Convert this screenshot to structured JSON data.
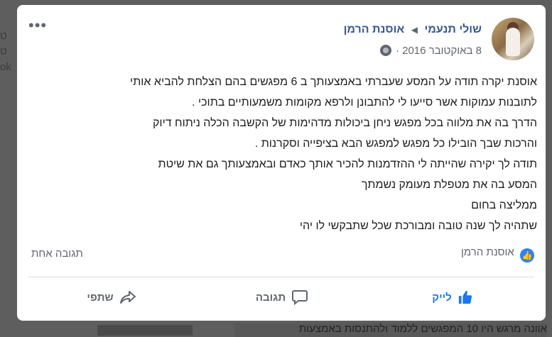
{
  "background": {
    "left_fragments": [
      "ט",
      "ט",
      "ok"
    ],
    "bottom_fragment": "אוונה מרגש היו 10 המפגשים ללמוד ולהתנסות באמצעות"
  },
  "post": {
    "author": "שולי תנעמי",
    "page": "אוסנת הרמן",
    "date": "8 באוקטובר 2016",
    "separator": "·",
    "lines": [
      "אוסנת יקרה תודה על המסע שעברתי באמצעותך ב 6 מפגשים בהם הצלחת להביא אותי",
      "לתובנות עמוקות אשר סייעו לי להתבונן ולרפא מקומות משמעותיים בתוכי .",
      "הדרך בה את מלווה בכל מפגש ניחן ביכולות מדהימות של הקשבה הכלה ניתוח דיוק",
      "והרכות שבך הובילו כל מפגש למפגש הבא בציפייה וסקרנות .",
      "תודה לך יקירה שהייתה לי ההזדמנות להכיר אותך כאדם ובאמצעותך גם את שיטת",
      "המסע בה את מטפלת מעומק נשמתך",
      "ממליצה בחום",
      "שתהיה לך שנה טובה ומבורכת שכל שתבקשי לו יהי"
    ],
    "reaction_name": "אוסנת הרמן",
    "comment_count": "תגובה אחת",
    "actions": {
      "like": "לייק",
      "comment": "תגובה",
      "share": "שתפי"
    }
  },
  "icons": [
    "more-icon",
    "globe-icon",
    "like-badge-icon",
    "like-icon",
    "comment-icon",
    "share-icon",
    "caret-icon"
  ],
  "colors": {
    "link": "#385898",
    "like_blue": "#1877f2",
    "meta": "#606770",
    "text": "#1c1e21"
  }
}
